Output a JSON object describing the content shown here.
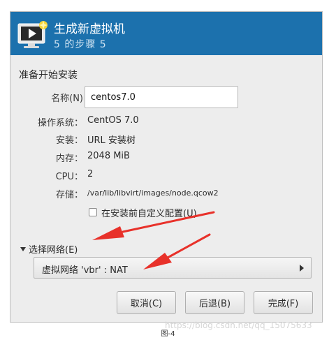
{
  "dialog": {
    "title": "生成新虚拟机",
    "step": "5 的步骤 5",
    "icon": "monitor-new-vm-icon"
  },
  "section": {
    "title": "准备开始安装"
  },
  "name_field": {
    "label": "名称(N)",
    "value": "centos7.0"
  },
  "details": [
    {
      "label": "操作系统：",
      "value": "CentOS 7.0"
    },
    {
      "label": "安装：",
      "value": "URL 安装树"
    },
    {
      "label": "内存：",
      "value": "2048 MiB"
    },
    {
      "label": "CPU：",
      "value": "2"
    },
    {
      "label": "存储：",
      "value": "/var/lib/libvirt/images/node.qcow2"
    }
  ],
  "customize_checkbox": {
    "label": "在安装前自定义配置(U)",
    "checked": false
  },
  "network": {
    "expander_label": "选择网络(E)",
    "selected": "虚拟网络 'vbr' : NAT"
  },
  "buttons": {
    "cancel": "取消(C)",
    "back": "后退(B)",
    "finish": "完成(F)"
  },
  "caption": "图-4",
  "watermark": "https://blog.csdn.net/qq_15075633",
  "colors": {
    "header": "#1c71ad",
    "annotation_arrow": "#e8312a"
  }
}
